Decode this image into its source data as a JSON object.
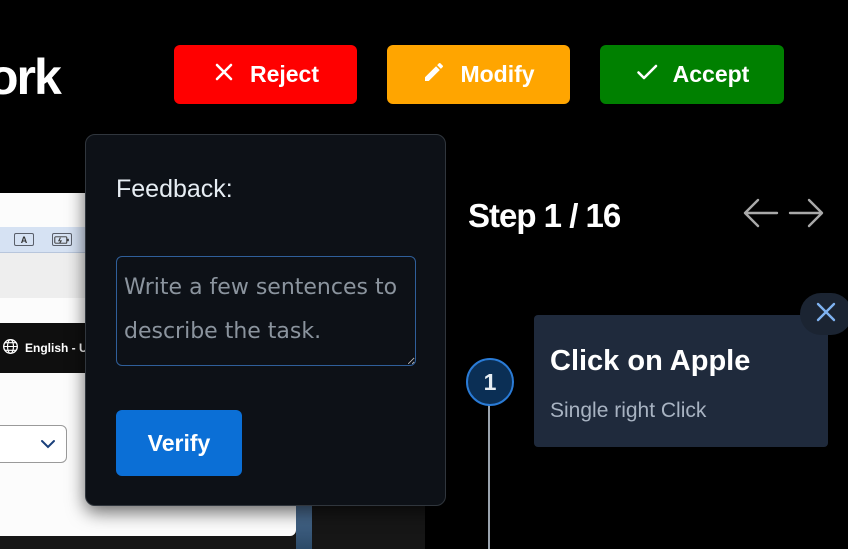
{
  "header": {
    "title_fragment": "ork"
  },
  "actions": {
    "reject_label": "Reject",
    "modify_label": "Modify",
    "accept_label": "Accept",
    "colors": {
      "reject": "#ff0000",
      "modify": "#ffa500",
      "accept": "#008000"
    }
  },
  "preview": {
    "toolbar_icons": [
      "A",
      "keyboard-battery-icon"
    ],
    "language_label": "English - U"
  },
  "feedback": {
    "label": "Feedback:",
    "placeholder": "Write a few sentences to describe the task.",
    "value": "",
    "verify_label": "Verify"
  },
  "step": {
    "title": "Step 1 / 16",
    "badge_number": "1",
    "card_title": "Click on Apple",
    "card_subtitle": "Single right Click"
  },
  "icons": {
    "reject": "close-icon",
    "modify": "pencil-icon",
    "accept": "checkmark-icon",
    "prev": "arrow-left-icon",
    "next": "arrow-right-icon",
    "close_card": "close-icon",
    "language": "globe-icon"
  }
}
